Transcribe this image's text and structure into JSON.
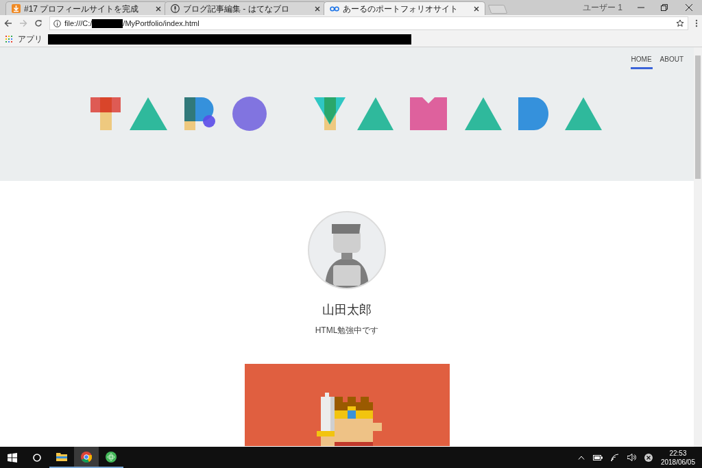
{
  "browser": {
    "tabs": [
      {
        "title": "#17 プロフィールサイトを完成",
        "selected": false
      },
      {
        "title": "ブログ記事編集 - はてなブロ",
        "selected": false
      },
      {
        "title": "あーるのポートフォリオサイト",
        "selected": true
      }
    ],
    "user": "ユーザー 1",
    "address": {
      "before": "file:///C:/",
      "after": "/MyPortfolio/index.html"
    },
    "bookmarks": {
      "apps_label": "アプリ"
    }
  },
  "page": {
    "nav": [
      {
        "label": "HOME",
        "selected": true
      },
      {
        "label": "ABOUT",
        "selected": false
      }
    ],
    "profile": {
      "name": "山田太郎",
      "tagline": "HTML勉強中です"
    }
  },
  "taskbar": {
    "time": "22:53",
    "date": "2018/06/05"
  }
}
